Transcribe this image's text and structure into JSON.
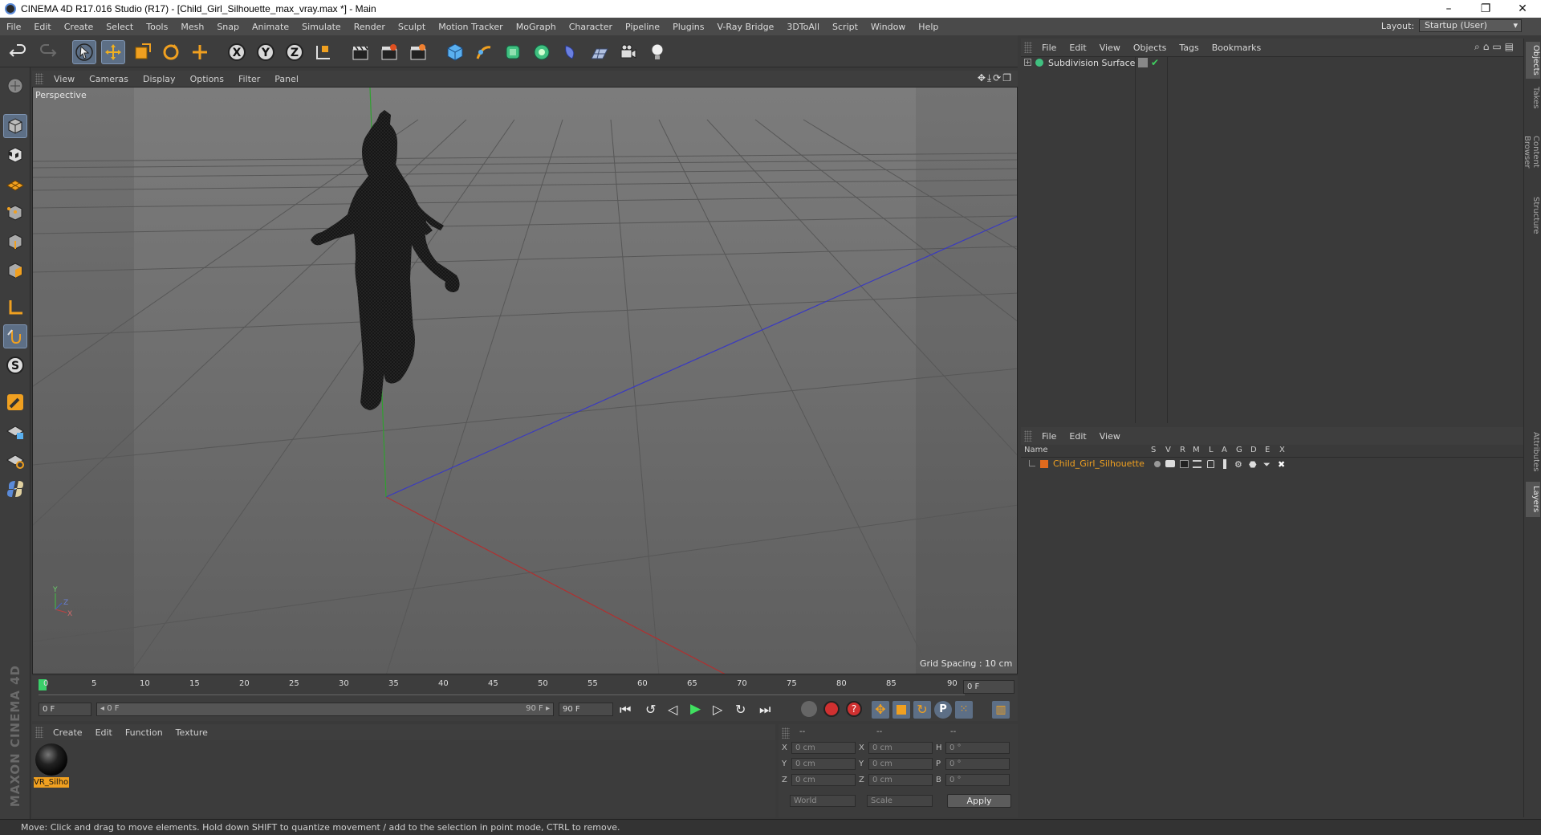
{
  "window": {
    "title": "CINEMA 4D R17.016 Studio (R17) - [Child_Girl_Silhouette_max_vray.max *] - Main",
    "controls": [
      "–",
      "❐",
      "✕"
    ]
  },
  "menu": [
    "File",
    "Edit",
    "Create",
    "Select",
    "Tools",
    "Mesh",
    "Snap",
    "Animate",
    "Simulate",
    "Render",
    "Sculpt",
    "Motion Tracker",
    "MoGraph",
    "Character",
    "Pipeline",
    "Plugins",
    "V-Ray Bridge",
    "3DToAll",
    "Script",
    "Window",
    "Help"
  ],
  "layout": {
    "label": "Layout:",
    "value": "Startup (User)"
  },
  "viewport": {
    "menu": [
      "View",
      "Cameras",
      "Display",
      "Options",
      "Filter",
      "Panel"
    ],
    "label": "Perspective",
    "grid_spacing": "Grid Spacing : 10 cm"
  },
  "timeline": {
    "ticks": [
      "0",
      "5",
      "10",
      "15",
      "20",
      "25",
      "30",
      "35",
      "40",
      "45",
      "50",
      "55",
      "60",
      "65",
      "70",
      "75",
      "80",
      "85",
      "90"
    ],
    "current_frame": "0 F",
    "start": "0 F",
    "range_start": "◂ 0 F",
    "range_end": "90 F ▸",
    "end": "90 F"
  },
  "materials": {
    "menu": [
      "Create",
      "Edit",
      "Function",
      "Texture"
    ],
    "items": [
      {
        "label": "VR_Silho"
      }
    ]
  },
  "coordinates": {
    "headers": [
      "--",
      "--",
      "--"
    ],
    "rows": [
      {
        "a": "X",
        "av": "0 cm",
        "b": "X",
        "bv": "0 cm",
        "c": "H",
        "cv": "0 °"
      },
      {
        "a": "Y",
        "av": "0 cm",
        "b": "Y",
        "bv": "0 cm",
        "c": "P",
        "cv": "0 °"
      },
      {
        "a": "Z",
        "av": "0 cm",
        "b": "Z",
        "bv": "0 cm",
        "c": "B",
        "cv": "0 °"
      }
    ],
    "world": "World",
    "scale": "Scale",
    "apply": "Apply"
  },
  "objects": {
    "menu": [
      "File",
      "Edit",
      "View",
      "Objects",
      "Tags",
      "Bookmarks"
    ],
    "items": [
      {
        "name": "Subdivision Surface"
      }
    ]
  },
  "layers": {
    "menu": [
      "File",
      "Edit",
      "View"
    ],
    "columns": [
      "Name",
      "S",
      "V",
      "R",
      "M",
      "L",
      "A",
      "G",
      "D",
      "E",
      "X"
    ],
    "rows": [
      {
        "name": "Child_Girl_Silhouette",
        "color": "#e06a1e"
      }
    ]
  },
  "right_tabs": [
    "Objects",
    "Takes",
    "Content Browser",
    "Structure",
    "Attributes",
    "Layers"
  ],
  "status": "Move: Click and drag to move elements. Hold down SHIFT to quantize movement / add to the selection in point mode, CTRL to remove.",
  "brand": "MAXON CINEMA 4D",
  "colors": {
    "accent": "#5d6f86",
    "axis_x": "#c03030",
    "axis_y": "#3ab03a",
    "axis_z": "#3040c0",
    "silhouette": "#1a1a1a"
  }
}
